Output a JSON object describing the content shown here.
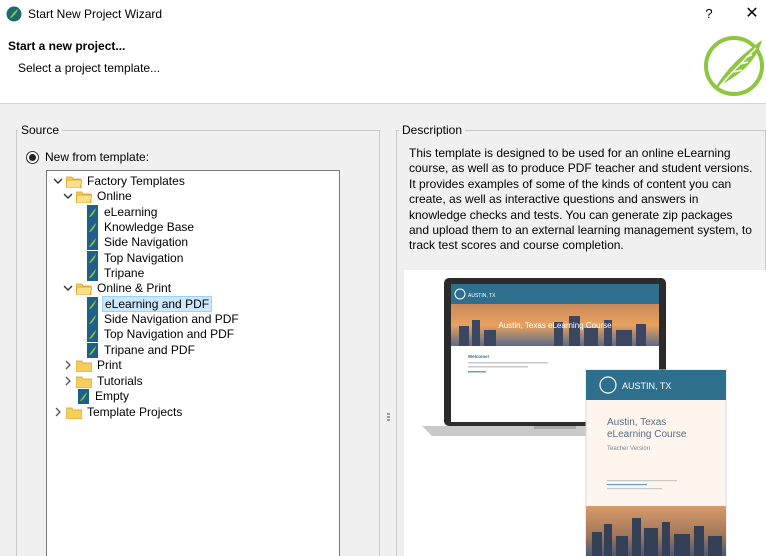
{
  "window": {
    "title": "Start New Project Wizard",
    "help_glyph": "?",
    "close_glyph": "✕"
  },
  "header": {
    "heading": "Start a new project...",
    "subheading": "Select a project template..."
  },
  "source": {
    "group_label": "Source",
    "radio_label": "New from template:",
    "tree": [
      {
        "label": "Factory Templates",
        "kind": "folder",
        "expanded": true
      },
      {
        "label": "Online",
        "kind": "folder",
        "expanded": true
      },
      {
        "label": "eLearning",
        "kind": "template"
      },
      {
        "label": "Knowledge Base",
        "kind": "template"
      },
      {
        "label": "Side Navigation",
        "kind": "template"
      },
      {
        "label": "Top Navigation",
        "kind": "template"
      },
      {
        "label": "Tripane",
        "kind": "template"
      },
      {
        "label": "Online & Print",
        "kind": "folder",
        "expanded": true
      },
      {
        "label": "eLearning and PDF",
        "kind": "template",
        "selected": true
      },
      {
        "label": "Side Navigation and PDF",
        "kind": "template"
      },
      {
        "label": "Top Navigation and PDF",
        "kind": "template"
      },
      {
        "label": "Tripane and PDF",
        "kind": "template"
      },
      {
        "label": "Print",
        "kind": "folder",
        "expanded": false
      },
      {
        "label": "Tutorials",
        "kind": "folder",
        "expanded": false
      },
      {
        "label": "Empty",
        "kind": "template"
      },
      {
        "label": "Template Projects",
        "kind": "folder",
        "expanded": false
      }
    ]
  },
  "description": {
    "group_label": "Description",
    "text": "This template is designed to be used for an online eLearning course, as well as to produce PDF teacher and student versions. It provides examples of some of the kinds of content you can create, as well as interactive questions and answers in knowledge checks and tests. You can generate zip packages and upload them to an external learning management system, to track test scores and course completion.",
    "preview": {
      "laptop_brand": "AUSTIN, TX",
      "laptop_banner": "Austin, Texas eLearning Course",
      "laptop_welcome": "Welcome!",
      "pdf_brand": "AUSTIN, TX",
      "pdf_title_line1": "Austin, Texas",
      "pdf_title_line2": "eLearning Course",
      "pdf_subtitle": "Teacher Version"
    }
  },
  "colors": {
    "accent_green": "#8dc63f",
    "selection_bg": "#cce8ff",
    "folder_yellow": "#f5cd5b",
    "doc_blue": "#1f5f8b",
    "brand_teal": "#2e6f8e"
  }
}
